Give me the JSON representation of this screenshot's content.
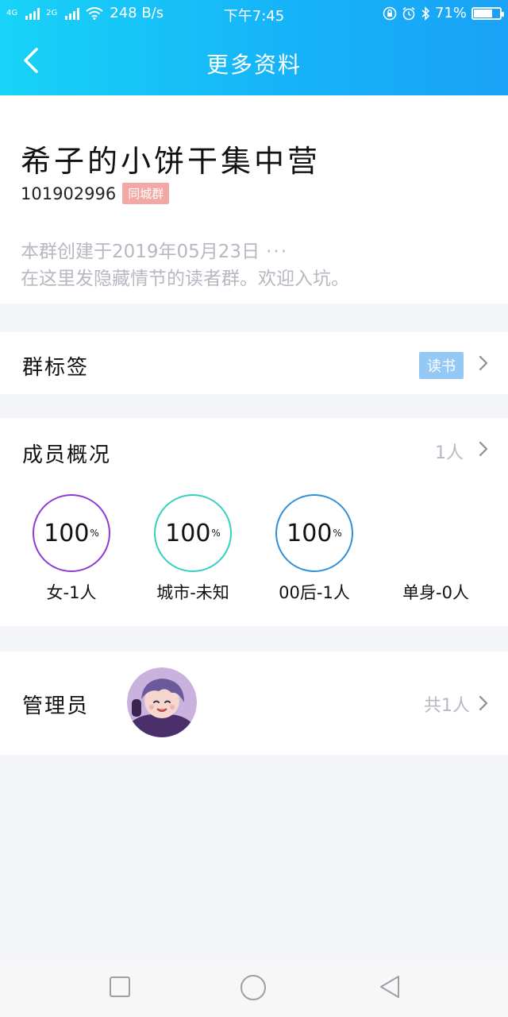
{
  "status_bar": {
    "net1": "4G",
    "net2": "2G",
    "speed": "248 B/s",
    "time": "下午7:45",
    "battery": "71%",
    "battery_level": 0.71
  },
  "header": {
    "title": "更多资料"
  },
  "group": {
    "name": "希子的小饼干集中营",
    "id": "101902996",
    "badge": "同城群",
    "desc_line1": "本群创建于2019年05月23日",
    "desc_more": "···",
    "desc_line2": "在这里发隐藏情节的读者群。欢迎入坑。"
  },
  "tags_row": {
    "label": "群标签",
    "tag": "读书"
  },
  "members": {
    "label": "成员概况",
    "count": "1人",
    "stats": [
      {
        "value": "100",
        "unit": "%",
        "label": "女-1人",
        "color": "#8e3ad8"
      },
      {
        "value": "100",
        "unit": "%",
        "label": "城市-未知",
        "color": "#35cfc0"
      },
      {
        "value": "100",
        "unit": "%",
        "label": "00后-1人",
        "color": "#2f8fd8"
      },
      {
        "value": "",
        "unit": "",
        "label": "单身-0人",
        "color": ""
      }
    ]
  },
  "admins": {
    "label": "管理员",
    "count": "共1人"
  }
}
